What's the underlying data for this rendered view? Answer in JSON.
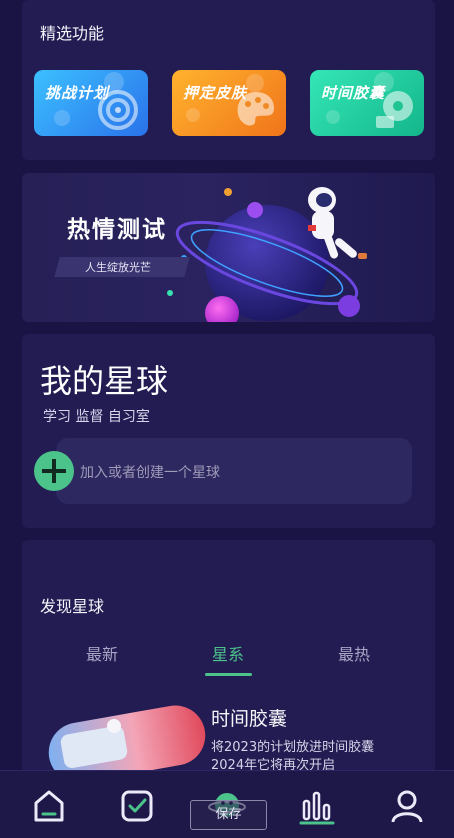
{
  "featured": {
    "title": "精选功能",
    "items": [
      {
        "label": "挑战计划",
        "color_from": "#38b6ff",
        "color_to": "#2b7df0"
      },
      {
        "label": "押定皮肤",
        "color_from": "#ffb02e",
        "color_to": "#f07a1a"
      },
      {
        "label": "时间胶囊",
        "color_from": "#2ee3b0",
        "color_to": "#15b98d"
      }
    ]
  },
  "banner": {
    "title": "热情测试",
    "subtitle": "人生绽放光芒"
  },
  "my_planet": {
    "title": "我的星球",
    "tags": "学习 监督 自习室",
    "join_placeholder": "加入或者创建一个星球"
  },
  "discover": {
    "title": "发现星球",
    "tabs": [
      "最新",
      "星系",
      "最热"
    ],
    "active_tab": "星系",
    "item": {
      "title": "时间胶囊",
      "desc_line1": "将2023的计划放进时间胶囊",
      "desc_line2": "2024年它将再次开启"
    }
  },
  "bottom_nav": {
    "items": [
      "home-icon",
      "checklist-icon",
      "planet-icon",
      "stats-icon",
      "profile-icon"
    ],
    "save_label": "保存"
  },
  "colors": {
    "accent": "#4cc38a",
    "background": "#1a1445",
    "card": "#221c52"
  }
}
